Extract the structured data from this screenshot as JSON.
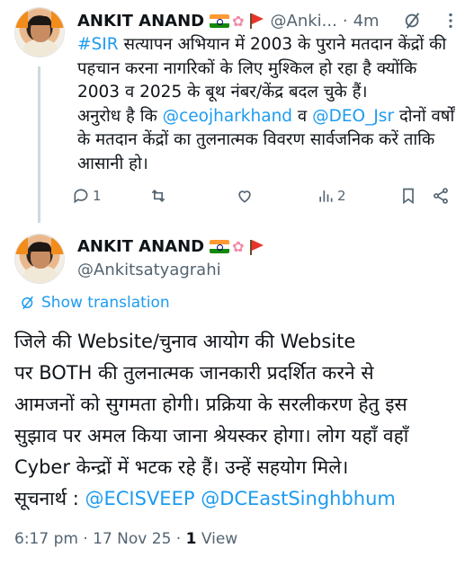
{
  "parent_tweet": {
    "author_name": "ANKIT ANAND",
    "handle": "@Anki...",
    "separator": "·",
    "time": "4m",
    "body_parts": [
      {
        "text": "#SIR",
        "link": true
      },
      {
        "text": " सत्यापन अभियान में 2003 के पुराने मतदान केंद्रों की पहचान करना नागरिकों के लिए मुश्किल हो रहा है क्योंकि 2003 व 2025 के बूथ नंबर/केंद्र बदल चुके हैं।",
        "link": false
      }
    ],
    "body_line2_parts": [
      {
        "text": "अनुरोध है कि ",
        "link": false
      },
      {
        "text": "@ceojharkhand",
        "link": true
      },
      {
        "text": " व ",
        "link": false
      },
      {
        "text": "@DEO_Jsr",
        "link": true
      },
      {
        "text": " दोनों वर्षों के मतदान केंद्रों का तुलनात्मक विवरण सार्वजनिक करें ताकि आसानी हो।",
        "link": false
      }
    ],
    "replies": "1",
    "retweets": "",
    "likes": "",
    "views": "2"
  },
  "focused_tweet": {
    "author_name": "ANKIT ANAND",
    "handle": "@Ankitsatyagrahi",
    "show_translation": "Show translation",
    "body_lines": [
      "जिले की Website/चुनाव आयोग की Website",
      "पर BOTH की तुलनात्मक जानकारी प्रदर्शित करने से",
      "आमजनों को सुगमता होगी। प्रक्रिया के सरलीकरण हेतु इस",
      "सुझाव पर अमल किया जाना श्रेयस्कर होगा। लोग यहाँ वहाँ",
      "Cyber केन्द्रों में भटक रहे हैं। उन्हें सहयोग मिले।"
    ],
    "last_line_prefix": "सूचनार्थ : ",
    "mention_1": "@ECISVEEP",
    "mention_2": "@DCEastSinghbhum",
    "timestamp": "6:17 pm · 17 Nov 25 · ",
    "view_count": "1",
    "view_label": " View"
  },
  "icons": [
    "avatar",
    "india-flag-icon",
    "lotus-icon",
    "red-pennant-icon",
    "grok-icon",
    "more-icon",
    "reply-icon",
    "retweet-icon",
    "like-icon",
    "views-icon",
    "bookmark-icon",
    "share-icon",
    "translate-icon"
  ],
  "colors": {
    "link": "#1d9bf0",
    "muted": "#536471",
    "text": "#0f1419",
    "thread_line": "#cfd9de"
  }
}
